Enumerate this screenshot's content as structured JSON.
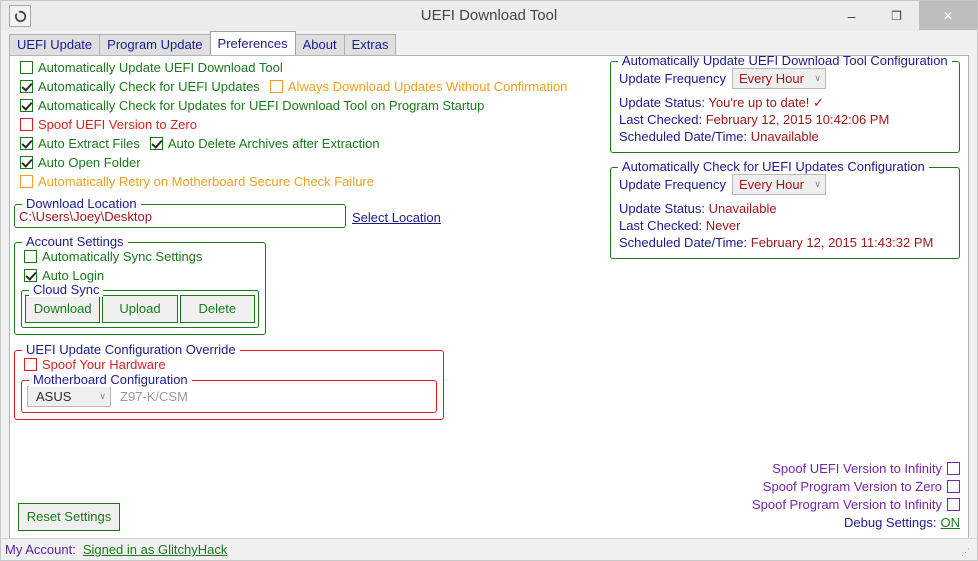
{
  "window": {
    "title": "UEFI Download Tool",
    "app_icon": "refresh-circle-icon",
    "minimize": "–",
    "maximize": "❐",
    "close": "✕"
  },
  "tabs": [
    {
      "label": "UEFI Update",
      "active": false
    },
    {
      "label": "Program Update",
      "active": false
    },
    {
      "label": "Preferences",
      "active": true
    },
    {
      "label": "About",
      "active": false
    },
    {
      "label": "Extras",
      "active": false
    }
  ],
  "preferences": {
    "options": [
      {
        "label": "Automatically Update UEFI Download Tool",
        "checked": false,
        "color": "green"
      },
      {
        "label": "Automatically Check for UEFI Updates",
        "checked": true,
        "color": "green"
      },
      {
        "label": "Always Download Updates Without Confirmation",
        "checked": false,
        "color": "orange"
      },
      {
        "label": "Automatically Check for Updates for UEFI Download Tool on Program Startup",
        "checked": true,
        "color": "green"
      },
      {
        "label": "Spoof UEFI Version to Zero",
        "checked": false,
        "color": "red"
      },
      {
        "label": "Auto Extract Files",
        "checked": true,
        "color": "green"
      },
      {
        "label": "Auto Delete Archives after Extraction",
        "checked": true,
        "color": "green"
      },
      {
        "label": "Auto Open Folder",
        "checked": true,
        "color": "green"
      },
      {
        "label": "Automatically Retry on Motherboard Secure Check Failure",
        "checked": false,
        "color": "orange"
      }
    ]
  },
  "download_location": {
    "legend": "Download Location",
    "value": "C:\\Users\\Joey\\Desktop",
    "select_link": "Select Location"
  },
  "account_settings": {
    "legend": "Account Settings",
    "options": [
      {
        "label": "Automatically Sync Settings",
        "checked": false,
        "color": "green"
      },
      {
        "label": "Auto Login",
        "checked": true,
        "color": "green"
      }
    ],
    "cloud_sync": {
      "legend": "Cloud Sync",
      "buttons": [
        "Download",
        "Upload",
        "Delete"
      ]
    }
  },
  "override": {
    "legend": "UEFI Update Configuration Override",
    "spoof_hardware": {
      "label": "Spoof Your Hardware",
      "checked": false,
      "color": "red"
    },
    "motherboard": {
      "legend": "Motherboard Configuration",
      "brand": "ASUS",
      "model_placeholder": "Z97-K/CSM",
      "chevron": "∨"
    }
  },
  "auto_update_config": {
    "legend": "Automatically Update UEFI Download Tool Configuration",
    "frequency_label": "Update Frequency",
    "frequency_value": "Every Hour",
    "chevron": "∨",
    "status_label": "Update Status:",
    "status_value": "You're up to date! ✓",
    "last_checked_label": "Last Checked:",
    "last_checked_value": "February 12, 2015 10:42:06 PM",
    "scheduled_label": "Scheduled Date/Time:",
    "scheduled_value": "Unavailable"
  },
  "auto_check_config": {
    "legend": "Automatically Check for UEFI Updates Configuration",
    "frequency_label": "Update Frequency",
    "frequency_value": "Every Hour",
    "chevron": "∨",
    "status_label": "Update Status:",
    "status_value": "Unavailable",
    "last_checked_label": "Last Checked:",
    "last_checked_value": "Never",
    "scheduled_label": "Scheduled Date/Time:",
    "scheduled_value": "February 12, 2015 11:43:32 PM"
  },
  "debug_panel": {
    "spoof_options": [
      {
        "label": "Spoof UEFI Version to Infinity",
        "checked": false
      },
      {
        "label": "Spoof Program Version to Zero",
        "checked": false
      },
      {
        "label": "Spoof Program Version to Infinity",
        "checked": false
      }
    ],
    "debug_label": "Debug Settings:",
    "debug_value": "ON"
  },
  "reset_button": "Reset Settings",
  "statusbar": {
    "label": "My Account:",
    "link": "Signed in as GlitchyHack",
    "grip": "⋰"
  },
  "colors": {
    "green": "#1a7a1a",
    "red": "#e02020",
    "orange": "#f0a020",
    "purple": "#7a24a8",
    "navy": "#1b1b8f",
    "darkred": "#a01818"
  }
}
